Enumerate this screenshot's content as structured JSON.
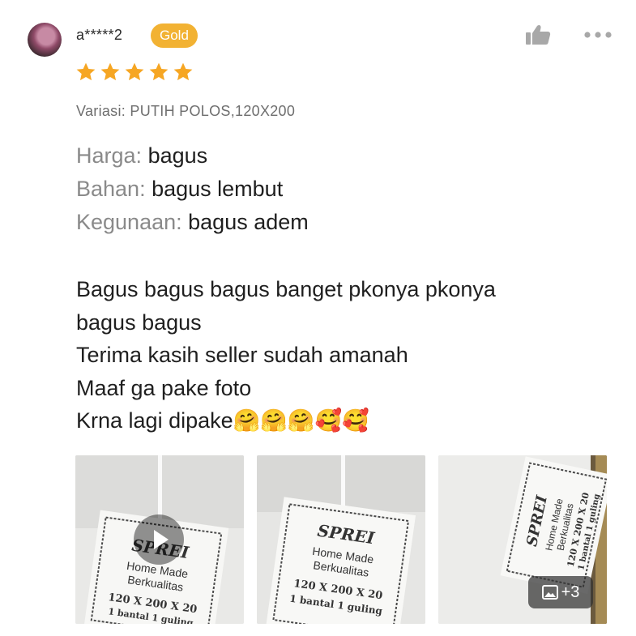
{
  "reviewer": {
    "name": "a*****2",
    "badge": "Gold",
    "avatar_icon": "avatar-photo"
  },
  "rating": {
    "stars": 5,
    "max": 5
  },
  "variation": "Variasi: PUTIH POLOS,120X200",
  "attributes": [
    {
      "key": "Harga:",
      "value": "bagus"
    },
    {
      "key": "Bahan:",
      "value": "bagus lembut"
    },
    {
      "key": "Kegunaan:",
      "value": "bagus adem"
    }
  ],
  "review_lines": [
    "Bagus bagus bagus banget pkonya pkonya",
    "bagus bagus",
    "Terima kasih seller sudah amanah",
    "Maaf ga pake foto",
    "Krna lagi dipake🤗🤗🤗🥰🥰"
  ],
  "media": {
    "photos": [
      {
        "tag_title": "SPREI",
        "tag_line1": "Home Made",
        "tag_line2": "Berkualitas",
        "tag_size": "120 X 200 X 20",
        "tag_extra": "1 bantal 1 guling",
        "is_video": true
      },
      {
        "tag_title": "SPREI",
        "tag_line1": "Home Made",
        "tag_line2": "Berkualitas",
        "tag_size": "120 X 200 X 20",
        "tag_extra": "1 bantal 1 guling",
        "is_video": false
      },
      {
        "tag_title": "SPREI",
        "tag_line1": "Home Made",
        "tag_line2": "Berkualitas",
        "tag_size": "120 X 200 X 20",
        "tag_extra": "1 bantal 1 guling",
        "is_video": false
      }
    ],
    "more_count": "+3"
  },
  "colors": {
    "badge": "#f2b233",
    "star": "#f6a623",
    "icon_gray": "#a8a8a8",
    "label_gray": "#8a8a8a"
  },
  "icons": {
    "like": "thumbs-up-icon",
    "more": "more-dots-icon",
    "play": "play-icon",
    "gallery": "image-icon"
  }
}
